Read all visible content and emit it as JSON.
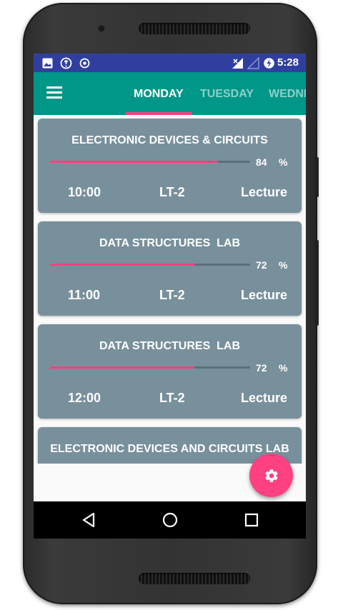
{
  "status_bar": {
    "time": "5:28",
    "left_icons": [
      "image-icon",
      "alert-circle-icon",
      "record-icon"
    ],
    "right_icons": [
      "signal-x-icon",
      "signal-empty-icon",
      "battery-charging-icon"
    ]
  },
  "app_bar": {
    "menu_icon": "menu-icon",
    "tabs": [
      {
        "label": "MONDAY",
        "active": true
      },
      {
        "label": "TUESDAY",
        "active": false
      },
      {
        "label": "WEDNE",
        "active": false
      }
    ],
    "colors": {
      "primary": "#009688",
      "status": "#303f9f",
      "accent": "#ff4081"
    }
  },
  "classes": [
    {
      "subject": "ELECTRONIC DEVICES & CIRCUITS",
      "attendance": 84,
      "percent_sign": "%",
      "time": "10:00",
      "room": "LT-2",
      "type": "Lecture"
    },
    {
      "subject": "DATA STRUCTURES  LAB",
      "attendance": 72,
      "percent_sign": "%",
      "time": "11:00",
      "room": "LT-2",
      "type": "Lecture"
    },
    {
      "subject": "DATA STRUCTURES  LAB",
      "attendance": 72,
      "percent_sign": "%",
      "time": "12:00",
      "room": "LT-2",
      "type": "Lecture"
    },
    {
      "subject": "ELECTRONIC DEVICES AND CIRCUITS LAB"
    }
  ],
  "card_color": "#78909c",
  "fab": {
    "icon": "settings-icon"
  },
  "nav_bar": {
    "buttons": [
      "back-icon",
      "home-icon",
      "recents-icon"
    ]
  }
}
